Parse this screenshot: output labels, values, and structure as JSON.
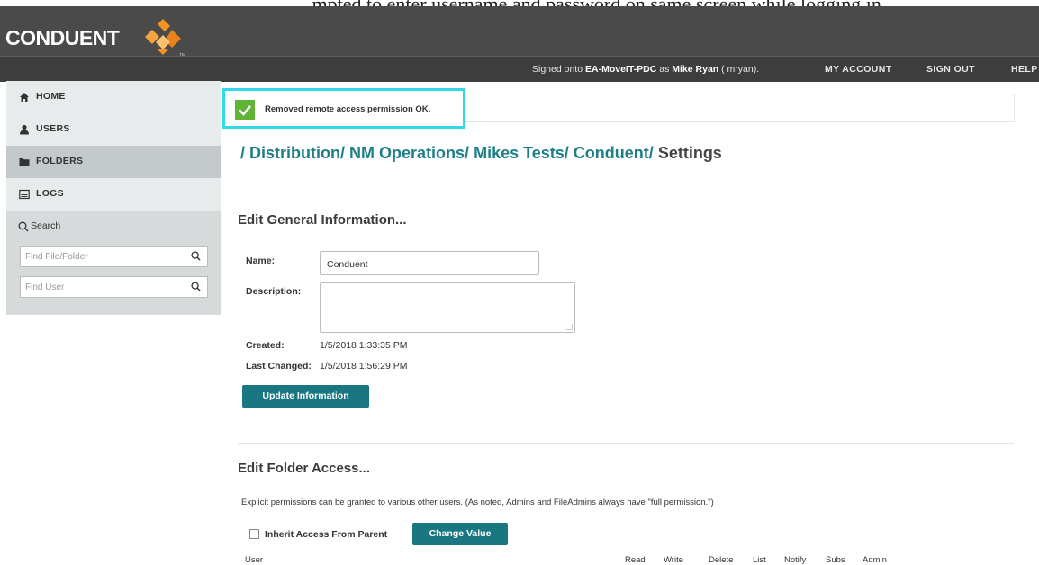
{
  "top_cropped_text": "...mpted to enter username and password on same screen while logging in...",
  "brand": {
    "logo_text": "CONDUENT",
    "tm": "TM",
    "colors": {
      "orange": "#f29221",
      "teal": "#1a7680",
      "alert_border": "#30d8e8",
      "success": "#5fb336"
    }
  },
  "header": {
    "signed_prefix": "Signed onto",
    "server": "EA-MoveIT-PDC",
    "as": "as",
    "user": "Mike Ryan",
    "username": "( mryan).",
    "links": [
      "MY ACCOUNT",
      "SIGN OUT",
      "HELP"
    ]
  },
  "sidebar": {
    "items": [
      {
        "label": "HOME",
        "icon": "home-icon"
      },
      {
        "label": "USERS",
        "icon": "user-icon"
      },
      {
        "label": "FOLDERS",
        "icon": "folder-icon"
      },
      {
        "label": "LOGS",
        "icon": "logs-icon"
      }
    ],
    "search": {
      "label": "Search",
      "file_placeholder": "Find File/Folder",
      "user_placeholder": "Find User"
    }
  },
  "alert": {
    "message": "Removed remote access permission OK."
  },
  "breadcrumb": {
    "items": [
      "Distribution/",
      "NM Operations/",
      "Mikes Tests/",
      "Conduent/"
    ],
    "current": "Settings",
    "separator": "/"
  },
  "general": {
    "heading": "Edit General Information...",
    "name_label": "Name:",
    "name_value": "Conduent",
    "description_label": "Description:",
    "description_value": "",
    "created_label": "Created:",
    "created_value": "1/5/2018 1:33:35 PM",
    "changed_label": "Last Changed:",
    "changed_value": "1/5/2018 1:56:29 PM",
    "update_button": "Update Information"
  },
  "access": {
    "heading": "Edit Folder Access...",
    "note": "Explicit permissions can be granted to various other users. (As noted, Admins and FileAdmins always have \"full permission.\")",
    "inherit_label": "Inherit Access From Parent",
    "change_button": "Change Value",
    "columns": [
      "Read",
      "Write",
      "Delete",
      "List",
      "Notify",
      "Subs",
      "Admin"
    ],
    "first_column": "User"
  }
}
